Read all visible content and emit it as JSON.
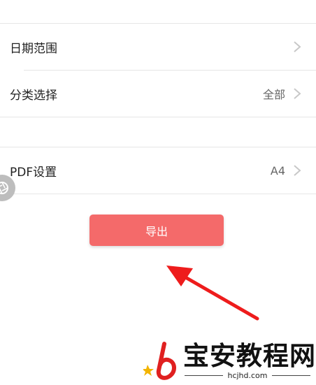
{
  "settings": {
    "rows": [
      {
        "label": "日期范围",
        "value": ""
      },
      {
        "label": "分类选择",
        "value": "全部"
      },
      {
        "label": "PDF设置",
        "value": "A4"
      }
    ]
  },
  "export_button": {
    "label": "导出"
  },
  "annotation": {
    "arrow_color": "#ee1c1c"
  },
  "watermark": {
    "text": "宝安教程网",
    "url": "hcjhd.com"
  },
  "colors": {
    "accent": "#f46a6a",
    "divider": "#e6e6e6",
    "chevron": "#c8c8c8"
  }
}
